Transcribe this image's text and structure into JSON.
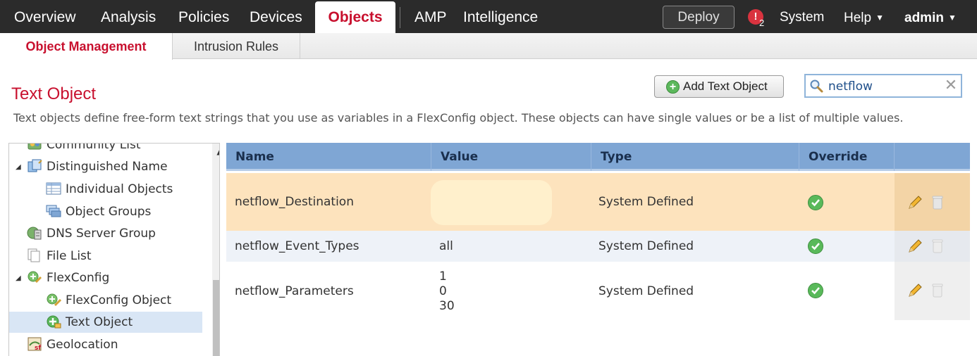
{
  "topnav": {
    "items": [
      "Overview",
      "Analysis",
      "Policies",
      "Devices",
      "Objects",
      "AMP",
      "Intelligence"
    ],
    "active": "Objects",
    "deploy": "Deploy",
    "alert_count": "2",
    "system": "System",
    "help": "Help",
    "user": "admin"
  },
  "subnav": {
    "tabs": [
      "Object Management",
      "Intrusion Rules"
    ],
    "active": "Object Management"
  },
  "page": {
    "title": "Text Object",
    "description": "Text objects define free-form text strings that you use as variables in a FlexConfig object. These objects can have single values or be a list of multiple values.",
    "add_button": "Add Text Object"
  },
  "search": {
    "value": "netflow",
    "placeholder": ""
  },
  "tree": {
    "items": [
      {
        "label": "Community List",
        "icon": "community-list-icon"
      },
      {
        "label": "Distinguished Name",
        "icon": "distinguished-name-icon",
        "expanded": true
      },
      {
        "label": "Individual Objects",
        "icon": "table-icon"
      },
      {
        "label": "Object Groups",
        "icon": "object-groups-icon"
      },
      {
        "label": "DNS Server Group",
        "icon": "dns-server-icon"
      },
      {
        "label": "File List",
        "icon": "file-list-icon"
      },
      {
        "label": "FlexConfig",
        "icon": "flexconfig-icon",
        "expanded": true
      },
      {
        "label": "FlexConfig Object",
        "icon": "flexconfig-object-icon"
      },
      {
        "label": "Text Object",
        "icon": "text-object-icon",
        "selected": true
      },
      {
        "label": "Geolocation",
        "icon": "geolocation-icon"
      }
    ]
  },
  "table": {
    "columns": [
      "Name",
      "Value",
      "Type",
      "Override"
    ],
    "rows": [
      {
        "name": "netflow_Destination",
        "value": [],
        "type": "System Defined",
        "override": true,
        "highlighted": true
      },
      {
        "name": "netflow_Event_Types",
        "value": [
          "all"
        ],
        "type": "System Defined",
        "override": true
      },
      {
        "name": "netflow_Parameters",
        "value": [
          "1",
          "0",
          "30"
        ],
        "type": "System Defined",
        "override": true
      }
    ]
  },
  "colors": {
    "brand_red": "#c8102e",
    "topbar": "#2b2b2b",
    "table_header": "#7fa6d4",
    "row_highlight": "#fde3bd",
    "row_alt": "#eef2f8"
  }
}
